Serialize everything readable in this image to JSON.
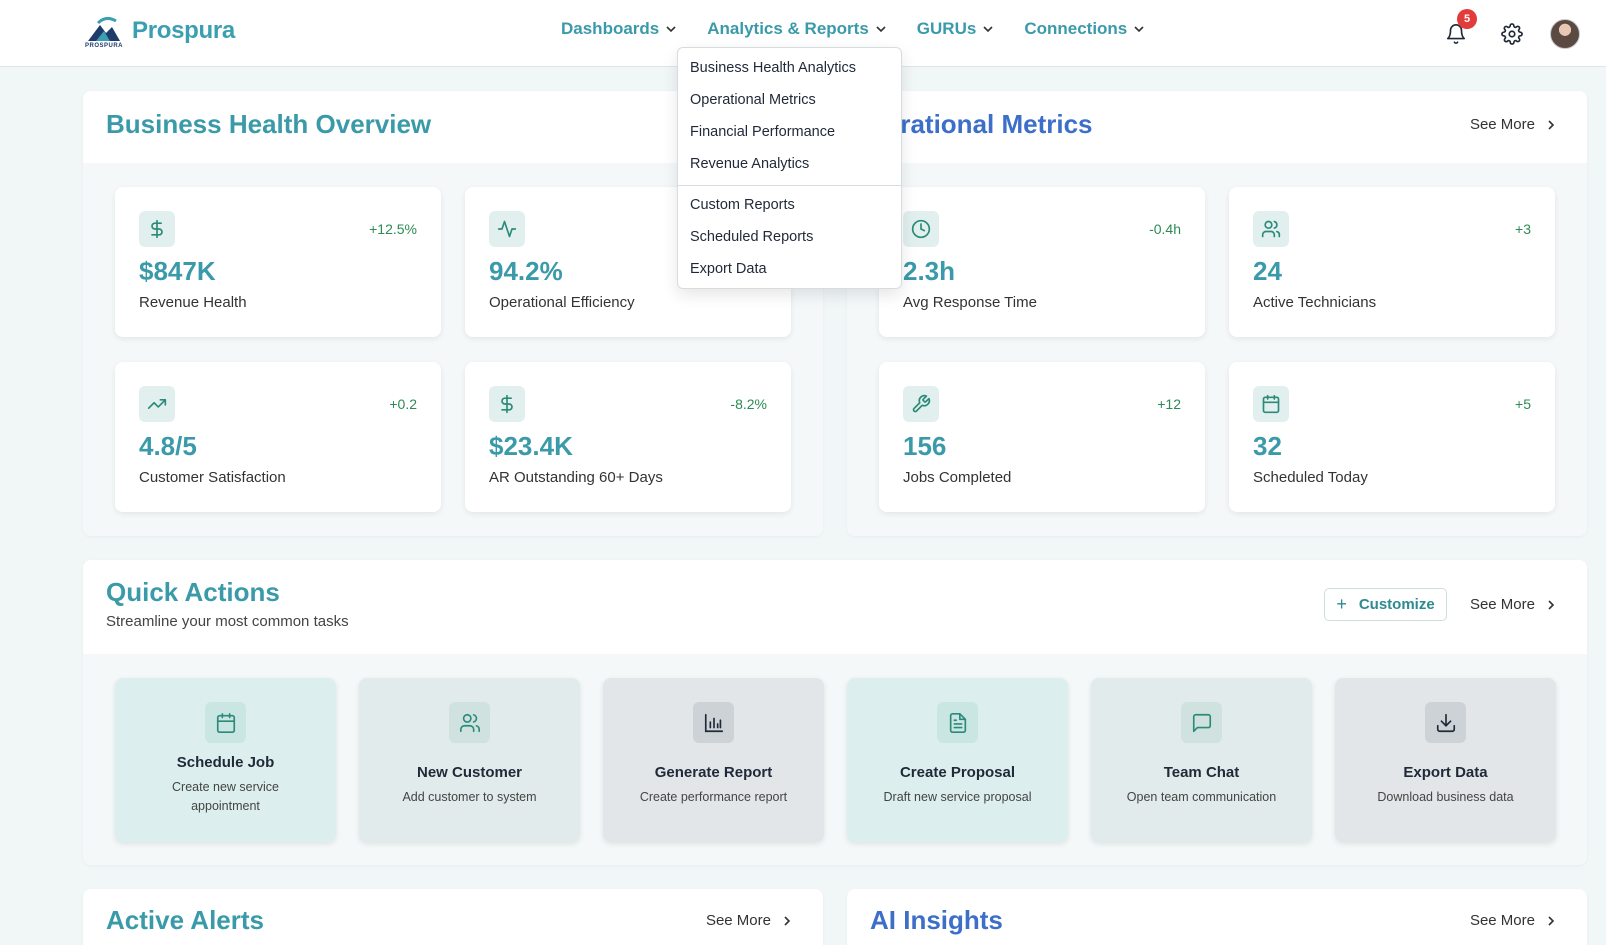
{
  "app": {
    "name": "Prospura",
    "logo_tag": "PROSPURA"
  },
  "nav": {
    "items": [
      {
        "label": "Dashboards"
      },
      {
        "label": "Analytics & Reports"
      },
      {
        "label": "GURUs"
      },
      {
        "label": "Connections"
      }
    ],
    "notification_count": "5"
  },
  "dropdown": {
    "group1": [
      "Business Health Analytics",
      "Operational Metrics",
      "Financial Performance",
      "Revenue Analytics"
    ],
    "group2": [
      "Custom Reports",
      "Scheduled Reports",
      "Export Data"
    ]
  },
  "business_health": {
    "title": "Business Health Overview",
    "metrics": [
      {
        "icon": "dollar-icon",
        "delta": "+12.5%",
        "value": "$847K",
        "label": "Revenue Health"
      },
      {
        "icon": "activity-icon",
        "delta": "",
        "value": "94.2%",
        "label": "Operational Efficiency"
      },
      {
        "icon": "trending-up-icon",
        "delta": "+0.2",
        "value": "4.8/5",
        "label": "Customer Satisfaction"
      },
      {
        "icon": "dollar-icon",
        "delta": "-8.2%",
        "value": "$23.4K",
        "label": "AR Outstanding 60+ Days"
      }
    ]
  },
  "operational": {
    "title": "perational Metrics",
    "see_more": "See More",
    "metrics": [
      {
        "icon": "clock-icon",
        "delta": "-0.4h",
        "value": "2.3h",
        "label": "Avg Response Time"
      },
      {
        "icon": "users-icon",
        "delta": "+3",
        "value": "24",
        "label": "Active Technicians"
      },
      {
        "icon": "wrench-icon",
        "delta": "+12",
        "value": "156",
        "label": "Jobs Completed"
      },
      {
        "icon": "calendar-icon",
        "delta": "+5",
        "value": "32",
        "label": "Scheduled Today"
      }
    ]
  },
  "quick_actions": {
    "title": "Quick Actions",
    "subtitle": "Streamline your most common tasks",
    "customize": "Customize",
    "see_more": "See More",
    "actions": [
      {
        "icon": "calendar-icon",
        "title": "Schedule Job",
        "desc": "Create new service appointment"
      },
      {
        "icon": "users-icon",
        "title": "New Customer",
        "desc": "Add customer to system"
      },
      {
        "icon": "bar-chart-icon",
        "title": "Generate Report",
        "desc": "Create performance report"
      },
      {
        "icon": "file-text-icon",
        "title": "Create Proposal",
        "desc": "Draft new service proposal"
      },
      {
        "icon": "message-square-icon",
        "title": "Team Chat",
        "desc": "Open team communication"
      },
      {
        "icon": "download-icon",
        "title": "Export Data",
        "desc": "Download business data"
      }
    ]
  },
  "alerts": {
    "title": "Active Alerts",
    "see_more": "See More"
  },
  "ai_insights": {
    "title": "AI Insights",
    "see_more": "See More"
  },
  "colors": {
    "accent": "#3a9aa9",
    "blue_title": "#3d6fc9",
    "positive": "#2d8a55",
    "badge": "#e23b3b"
  }
}
